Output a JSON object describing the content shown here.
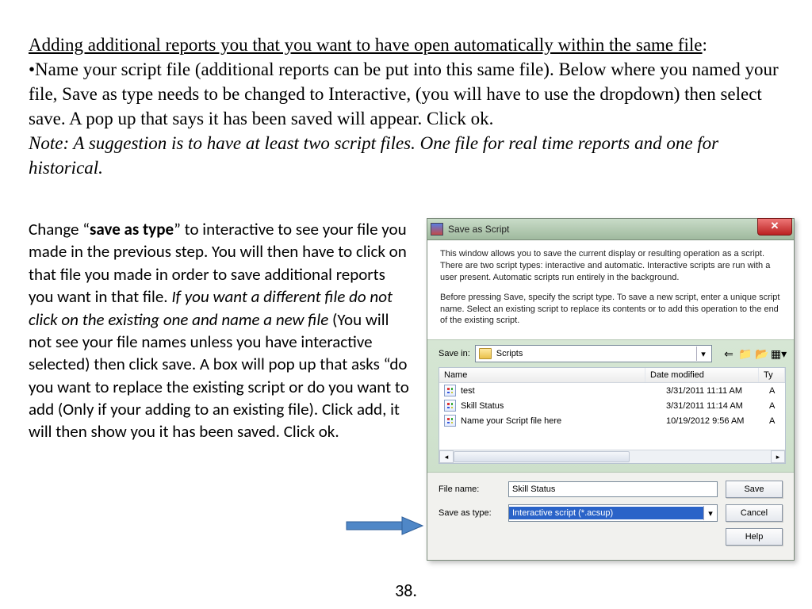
{
  "doc": {
    "heading_underline": "Adding additional reports you that you want to have open automatically within the same file",
    "heading_tail": ":",
    "body1_a": "•Name your script file (additional reports can be put into this same file).  Below where you named your file, Save as type needs to be changed to Interactive, (you will have to use the dropdown) then select save. A pop up that says it has been saved will appear. Click ok.",
    "body1_note": "Note: A suggestion is to have at least two script files. One file for real time reports and one for historical.",
    "left_a": "Change “",
    "left_bold": "save as type",
    "left_b": "” to interactive to see your file you made in the previous step. You will then have to click on that file you made in order to save additional reports you want in that file. ",
    "left_ital": "If you want a different file do not click on the existing one and name a new file",
    "left_c": " (You will not see your file names unless you have interactive selected) then click save. A box will pop up that asks “do you want to replace the existing script or do you want to add (Only if your adding to an existing file). Click add, it will then show you it has been saved. Click ok.",
    "page_number": "38."
  },
  "dialog": {
    "title": "Save as Script",
    "desc1": "This window allows you to save the current display or resulting operation as a script. There are two script types:  interactive and automatic.  Interactive scripts are run with a user present.  Automatic scripts run entirely in the background.",
    "desc2": "Before pressing Save, specify the script type.  To save a new script, enter a unique script name.  Select an existing script to replace its contents or to add this operation to the end of the existing script.",
    "savein_label": "Save in:",
    "savein_value": "Scripts",
    "columns": {
      "name": "Name",
      "date": "Date modified",
      "type": "Ty"
    },
    "files": [
      {
        "name": "test",
        "date": "3/31/2011 11:11 AM",
        "type": "A"
      },
      {
        "name": "Skill Status",
        "date": "3/31/2011 11:14 AM",
        "type": "A"
      },
      {
        "name": "Name your Script file here",
        "date": "10/19/2012 9:56 AM",
        "type": "A"
      }
    ],
    "filename_label": "File name:",
    "filename_value": "Skill Status",
    "saveastype_label": "Save as type:",
    "saveastype_value": "Interactive script (*.acsup)",
    "buttons": {
      "save": "Save",
      "cancel": "Cancel",
      "help": "Help"
    }
  }
}
